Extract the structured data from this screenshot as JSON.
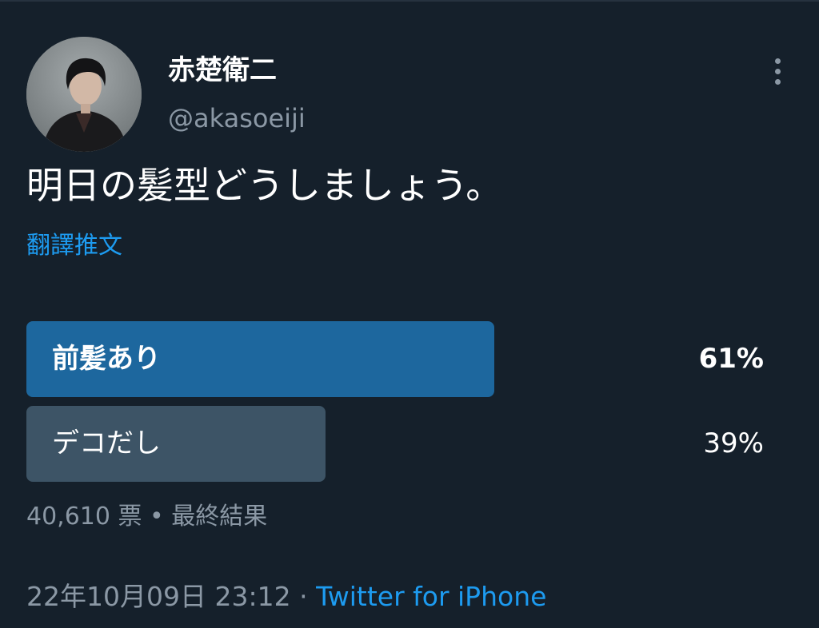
{
  "author": {
    "display_name": "赤楚衛二",
    "username": "@akasoeiji"
  },
  "tweet": {
    "text": "明日の髪型どうしましょう。",
    "translate_label": "翻譯推文"
  },
  "poll": {
    "options": [
      {
        "label": "前髪あり",
        "percent_text": "61%",
        "percent": 61,
        "winner": true
      },
      {
        "label": "デコだし",
        "percent_text": "39%",
        "percent": 39,
        "winner": false
      }
    ],
    "votes": "40,610 票",
    "separator": " • ",
    "status": "最終結果"
  },
  "meta": {
    "timestamp": "22年10月09日 23:12",
    "separator": " · ",
    "source": "Twitter for iPhone"
  },
  "colors": {
    "background": "#15202b",
    "accent": "#1d9bf0",
    "winner_bar": "#1d679e",
    "other_bar": "#3d5466",
    "secondary_text": "#8b98a5"
  },
  "icons": {
    "more": "more-vertical-icon"
  }
}
